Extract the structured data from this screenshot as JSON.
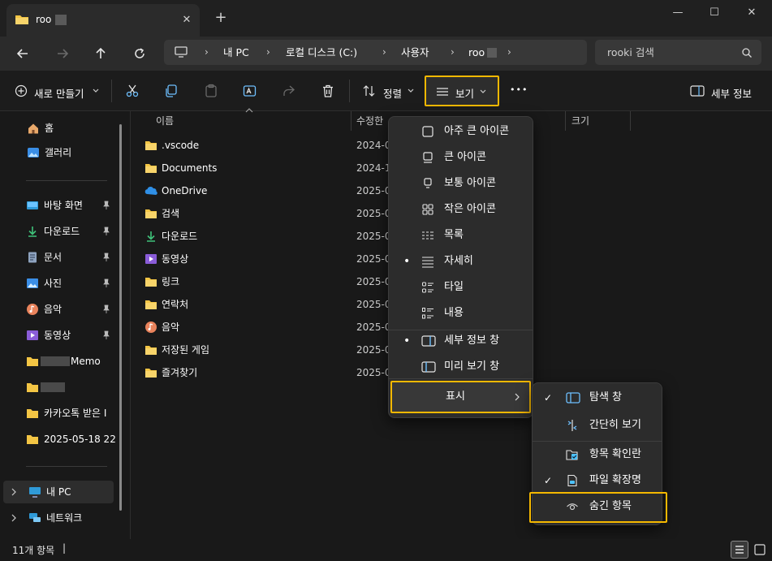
{
  "window": {
    "tab_title": "roo",
    "close_tab_glyph": "✕",
    "new_tab_glyph": "+",
    "minimize_glyph": "—",
    "maximize_glyph": "☐",
    "close_glyph": "✕"
  },
  "addressbar": {
    "crumbs": [
      "내 PC",
      "로컬 디스크 (C:)",
      "사용자",
      "roo"
    ],
    "separator": "›",
    "search_placeholder": "rooki 검색"
  },
  "toolbar": {
    "new_label": "새로 만들기",
    "sort_label": "정렬",
    "view_label": "보기",
    "more_label": "•••",
    "details_label": "세부 정보"
  },
  "nav": {
    "top": [
      {
        "label": "홈",
        "icon": "home-icon"
      },
      {
        "label": "갤러리",
        "icon": "gallery-icon"
      }
    ],
    "pinned": [
      {
        "label": "바탕 화면",
        "icon": "desktop-icon",
        "pinned": true
      },
      {
        "label": "다운로드",
        "icon": "download-icon",
        "pinned": true
      },
      {
        "label": "문서",
        "icon": "document-icon",
        "pinned": true
      },
      {
        "label": "사진",
        "icon": "pictures-icon",
        "pinned": true
      },
      {
        "label": "음악",
        "icon": "music-icon",
        "pinned": true
      },
      {
        "label": "동영상",
        "icon": "video-icon",
        "pinned": true
      },
      {
        "label": "Memo",
        "icon": "folder-icon"
      },
      {
        "label": "",
        "icon": "folder-icon"
      },
      {
        "label": "카카오톡 받은 I",
        "icon": "folder-icon"
      },
      {
        "label": "2025-05-18 22",
        "icon": "folder-icon"
      }
    ],
    "bottom": [
      {
        "label": "내 PC",
        "icon": "pc-icon"
      },
      {
        "label": "네트워크",
        "icon": "network-icon"
      }
    ],
    "pin_glyph": "📌"
  },
  "filelist": {
    "headers": {
      "name": "이름",
      "modified": "수정한",
      "size": "크기"
    },
    "files": [
      {
        "name": ".vscode",
        "date": "2024-0",
        "icon": "folder-icon"
      },
      {
        "name": "Documents",
        "date": "2024-1",
        "icon": "folder-icon"
      },
      {
        "name": "OneDrive",
        "date": "2025-0",
        "icon": "onedrive-icon"
      },
      {
        "name": "검색",
        "date": "2025-0",
        "icon": "folder-icon"
      },
      {
        "name": "다운로드",
        "date": "2025-0",
        "icon": "download-icon"
      },
      {
        "name": "동영상",
        "date": "2025-0",
        "icon": "video-icon"
      },
      {
        "name": "링크",
        "date": "2025-0",
        "icon": "folder-icon"
      },
      {
        "name": "연락처",
        "date": "2025-0",
        "icon": "folder-icon"
      },
      {
        "name": "음악",
        "date": "2025-0",
        "icon": "music-icon"
      },
      {
        "name": "저장된 게임",
        "date": "2025-0",
        "icon": "folder-icon"
      },
      {
        "name": "즐겨찾기",
        "date": "2025-0",
        "icon": "folder-icon"
      }
    ]
  },
  "view_menu": {
    "items": [
      {
        "label": "아주 큰 아이콘",
        "icon": "extra-large-icons-icon",
        "selected": false
      },
      {
        "label": "큰 아이콘",
        "icon": "large-icons-icon",
        "selected": false
      },
      {
        "label": "보통 아이콘",
        "icon": "medium-icons-icon",
        "selected": false
      },
      {
        "label": "작은 아이콘",
        "icon": "small-icons-icon",
        "selected": false
      },
      {
        "label": "목록",
        "icon": "list-icon",
        "selected": false
      },
      {
        "label": "자세히",
        "icon": "details-icon",
        "selected": true
      },
      {
        "label": "타일",
        "icon": "tiles-icon",
        "selected": false
      },
      {
        "label": "내용",
        "icon": "content-icon",
        "selected": false
      }
    ],
    "panes": [
      {
        "label": "세부 정보 창",
        "icon": "details-pane-icon",
        "selected": true
      },
      {
        "label": "미리 보기 창",
        "icon": "preview-pane-icon",
        "selected": false
      }
    ],
    "show_label": "표시",
    "selected_dot": "•"
  },
  "show_submenu": {
    "items": [
      {
        "label": "탐색 창",
        "icon": "navigation-pane-icon",
        "checked": true
      },
      {
        "label": "간단히 보기",
        "icon": "compact-view-icon",
        "checked": false
      },
      {
        "label": "항목 확인란",
        "icon": "item-checkbox-icon",
        "checked": false
      },
      {
        "label": "파일 확장명",
        "icon": "file-extension-icon",
        "checked": true
      },
      {
        "label": "숨긴 항목",
        "icon": "hidden-items-icon",
        "checked": false
      }
    ],
    "check_glyph": "✓"
  },
  "status": {
    "count": "11개 항목",
    "divider": "|"
  },
  "colors": {
    "highlight": "#f5b800",
    "folder": "#f3c544",
    "accent": "#4cc2ff"
  }
}
